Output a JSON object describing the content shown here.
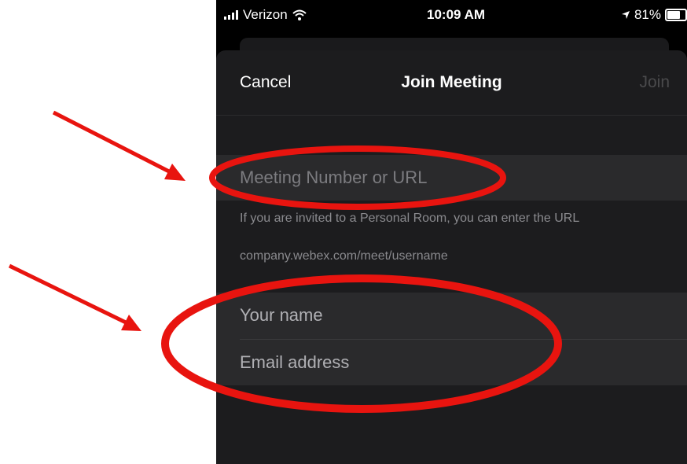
{
  "status_bar": {
    "carrier": "Verizon",
    "time": "10:09 AM",
    "battery": "81%",
    "battery_level": 0.81
  },
  "nav": {
    "cancel_label": "Cancel",
    "title": "Join Meeting",
    "join_label": "Join"
  },
  "meeting_field": {
    "placeholder": "Meeting Number or URL",
    "value": ""
  },
  "hints": {
    "line1": "If you are invited to a Personal Room, you can enter the URL",
    "line2": "company.webex.com/meet/username"
  },
  "identity": {
    "name_placeholder": "Your name",
    "email_placeholder": "Email address"
  },
  "annotation_color": "#e8140f",
  "icons": [
    "signal-icon",
    "wifi-icon",
    "location-arrow-icon",
    "battery-icon",
    "annotation-arrow-icon",
    "annotation-ellipse-icon"
  ]
}
